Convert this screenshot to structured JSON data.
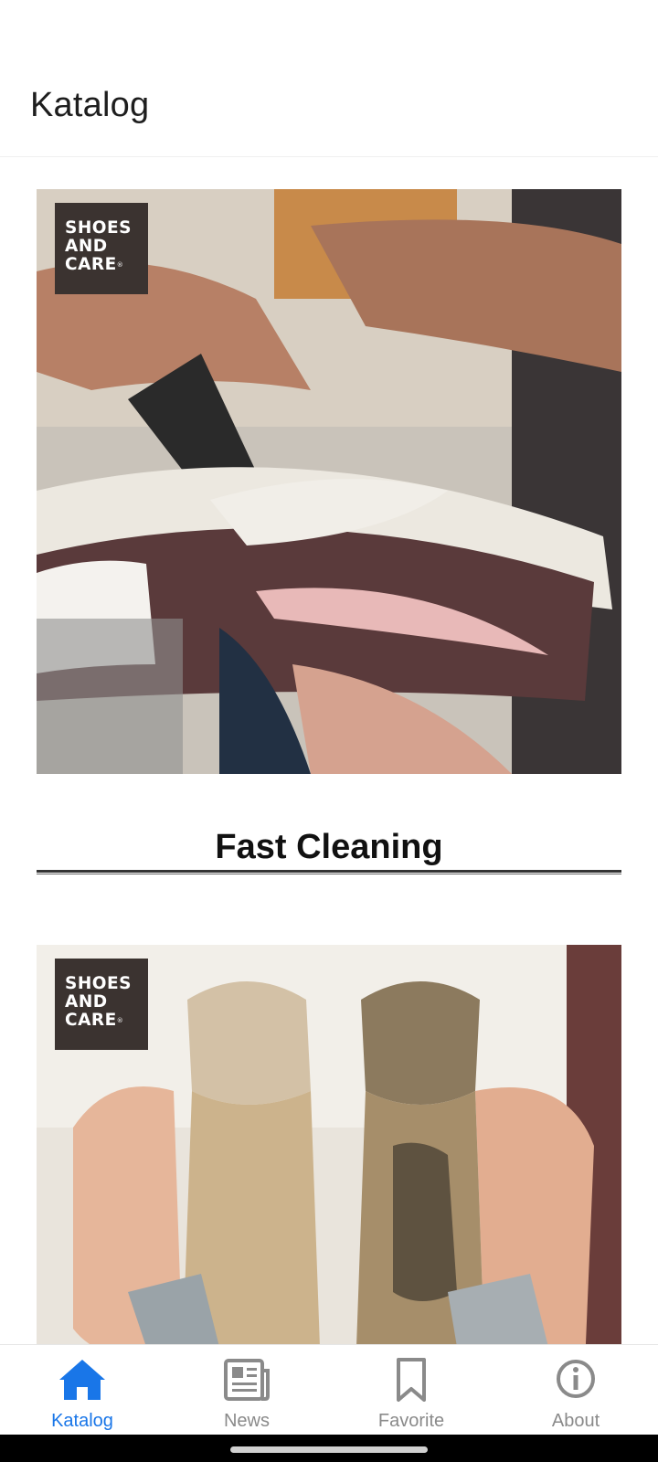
{
  "app_bar": {
    "title": "Katalog"
  },
  "cards": [
    {
      "brand": [
        "SHOES",
        "AND",
        "CARE"
      ],
      "title": "Fast Cleaning",
      "image": "sneaker-cleaning-photo"
    },
    {
      "brand": [
        "SHOES",
        "AND",
        "CARE"
      ],
      "title": "",
      "image": "dirty-soles-photo"
    }
  ],
  "bottom_nav": {
    "items": [
      {
        "label": "Katalog",
        "icon": "home-icon",
        "active": true
      },
      {
        "label": "News",
        "icon": "newspaper-icon",
        "active": false
      },
      {
        "label": "Favorite",
        "icon": "bookmark-icon",
        "active": false
      },
      {
        "label": "About",
        "icon": "info-icon",
        "active": false
      }
    ]
  },
  "colors": {
    "accent": "#1976e8",
    "inactive": "#8a8a8a",
    "badge": "#3b3330"
  }
}
